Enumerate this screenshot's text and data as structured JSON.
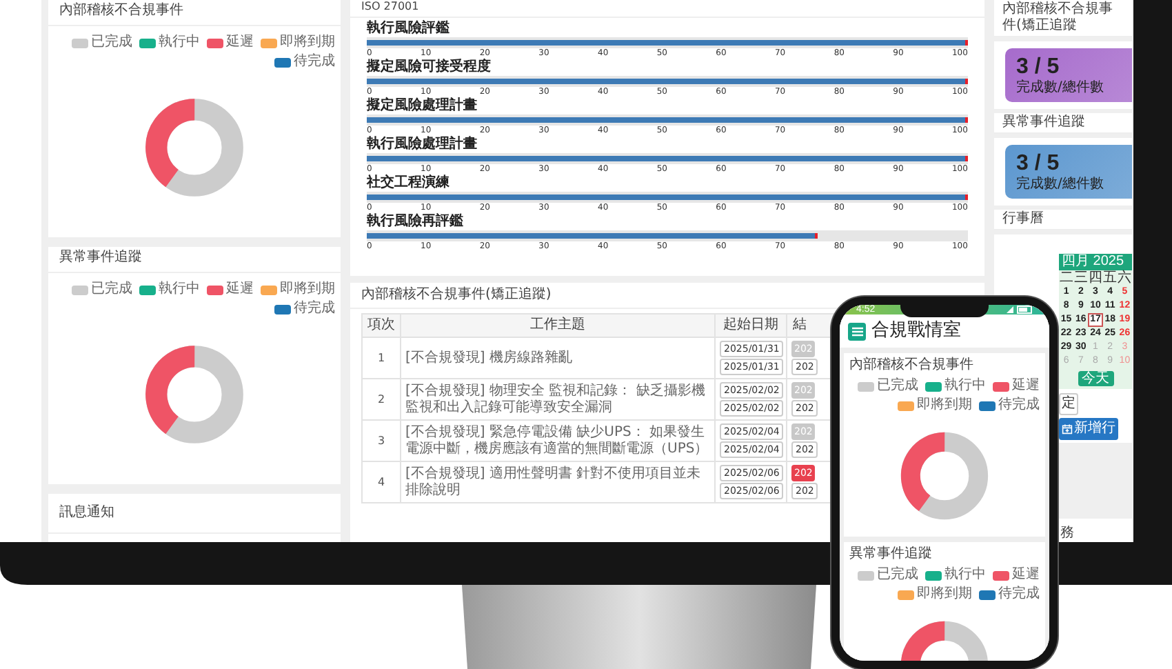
{
  "screen": {
    "left_column": [
      {
        "kind": "donut",
        "title": "內部稽核不合規事件",
        "legend": [
          {
            "label": "已完成",
            "color": "#cccccc"
          },
          {
            "label": "執行中",
            "color": "#17b08b"
          },
          {
            "label": "延遲",
            "color": "#ef5466"
          },
          {
            "label": "即將到期",
            "color": "#f9a851"
          },
          {
            "label": "待完成",
            "color": "#1f77b4"
          }
        ]
      },
      {
        "kind": "donut",
        "title": "異常事件追蹤",
        "legend": [
          {
            "label": "已完成",
            "color": "#cccccc"
          },
          {
            "label": "執行中",
            "color": "#17b08b"
          },
          {
            "label": "延遲",
            "color": "#ef5466"
          },
          {
            "label": "即將到期",
            "color": "#f9a851"
          },
          {
            "label": "待完成",
            "color": "#1f77b4"
          }
        ]
      },
      {
        "kind": "empty",
        "title": "訊息通知"
      }
    ],
    "iso_panel": {
      "title": "ISO 27001",
      "gauges": [
        {
          "label": "執行風險評鑑",
          "level": 1,
          "ticks": [
            "0",
            "10",
            "20",
            "30",
            "40",
            "50",
            "60",
            "70",
            "80",
            "90",
            "100"
          ]
        },
        {
          "label": "擬定風險可接受程度",
          "level": 1,
          "ticks": [
            "0",
            "10",
            "20",
            "30",
            "40",
            "50",
            "60",
            "70",
            "80",
            "90",
            "100"
          ]
        },
        {
          "label": "擬定風險處理計畫",
          "level": 1,
          "ticks": [
            "0",
            "10",
            "20",
            "30",
            "40",
            "50",
            "60",
            "70",
            "80",
            "90",
            "100"
          ]
        },
        {
          "label": "執行風險處理計畫",
          "level": 1,
          "ticks": [
            "0",
            "10",
            "20",
            "30",
            "40",
            "50",
            "60",
            "70",
            "80",
            "90",
            "100"
          ]
        },
        {
          "label": "社交工程演練",
          "level": 1,
          "ticks": [
            "0",
            "10",
            "20",
            "30",
            "40",
            "50",
            "60",
            "70",
            "80",
            "90",
            "100"
          ]
        },
        {
          "label": "執行風險再評鑑",
          "level": 0.75,
          "ticks": [
            "0",
            "10",
            "20",
            "30",
            "40",
            "50",
            "60",
            "70",
            "80",
            "90",
            "100"
          ]
        }
      ]
    },
    "table_panel": {
      "title": "內部稽核不合規事件(矯正追蹤)",
      "columns": [
        "項次",
        "工作主題",
        "起始日期",
        "結"
      ],
      "rows": [
        {
          "index": "1",
          "subject": "[不合規發現] 機房線路雜亂",
          "start_dates": [
            "2025/01/31",
            "2025/01/31"
          ],
          "end_status": {
            "text": "202",
            "color": "#c8c8c8"
          },
          "end_date": "202"
        },
        {
          "index": "2",
          "subject": "[不合規發現] 物理安全 監視和記錄： 缺乏攝影機監視和出入記錄可能導致安全漏洞",
          "start_dates": [
            "2025/02/02",
            "2025/02/02"
          ],
          "end_status": {
            "text": "202",
            "color": "#c8c8c8"
          },
          "end_date": "202"
        },
        {
          "index": "3",
          "subject": "[不合規發現] 緊急停電設備 缺少UPS： 如果發生電源中斷，機房應該有適當的無間斷電源（UPS）",
          "start_dates": [
            "2025/02/04",
            "2025/02/04"
          ],
          "end_status": {
            "text": "202",
            "color": "#c8c8c8"
          },
          "end_date": "202"
        },
        {
          "index": "4",
          "subject": "[不合規發現] 適用性聲明書 針對不使用項目並未排除說明",
          "start_dates": [
            "2025/02/06",
            "2025/02/06"
          ],
          "end_status": {
            "text": "202",
            "color": "#e8414f"
          },
          "end_date": "202"
        }
      ]
    },
    "right_column": {
      "cards": [
        {
          "title": "內部稽核不合規事件(矯正追蹤",
          "value": "3 / 5",
          "caption": "完成數/總件數",
          "color": "#a66bcc"
        },
        {
          "title": "異常事件追蹤",
          "value": "3 / 5",
          "caption": "完成數/總件數",
          "color": "#5c97cf"
        }
      ],
      "calendar": {
        "title": "行事曆",
        "month": "四月 2025",
        "weekdays": [
          "二",
          "三",
          "四",
          "五",
          "六"
        ],
        "weeks": [
          [
            {
              "day": "1",
              "kind": "day"
            },
            {
              "day": "2",
              "kind": "day"
            },
            {
              "day": "3",
              "kind": "day"
            },
            {
              "day": "4",
              "kind": "day"
            },
            {
              "day": "5",
              "kind": "weekend"
            }
          ],
          [
            {
              "day": "8",
              "kind": "day"
            },
            {
              "day": "9",
              "kind": "day"
            },
            {
              "day": "10",
              "kind": "day"
            },
            {
              "day": "11",
              "kind": "day"
            },
            {
              "day": "12",
              "kind": "weekend"
            }
          ],
          [
            {
              "day": "15",
              "kind": "day"
            },
            {
              "day": "16",
              "kind": "day"
            },
            {
              "day": "17",
              "kind": "today"
            },
            {
              "day": "18",
              "kind": "day"
            },
            {
              "day": "19",
              "kind": "weekend"
            }
          ],
          [
            {
              "day": "22",
              "kind": "day"
            },
            {
              "day": "23",
              "kind": "day"
            },
            {
              "day": "24",
              "kind": "day"
            },
            {
              "day": "25",
              "kind": "day"
            },
            {
              "day": "26",
              "kind": "weekend"
            }
          ],
          [
            {
              "day": "29",
              "kind": "day"
            },
            {
              "day": "30",
              "kind": "day"
            },
            {
              "day": "1",
              "kind": "other"
            },
            {
              "day": "2",
              "kind": "other"
            },
            {
              "day": "3",
              "kind": "other_weekend"
            }
          ],
          [
            {
              "day": "6",
              "kind": "other"
            },
            {
              "day": "7",
              "kind": "other"
            },
            {
              "day": "8",
              "kind": "other"
            },
            {
              "day": "9",
              "kind": "other"
            },
            {
              "day": "10",
              "kind": "other_weekend"
            }
          ]
        ],
        "today_button": "今天",
        "buttons": [
          {
            "label": "定",
            "kind": "plain"
          },
          {
            "label": "新增行",
            "kind": "primary"
          }
        ]
      },
      "footer_title": "務"
    }
  },
  "phone": {
    "time": "4:52",
    "app_title": "合規戰情室",
    "panels": [
      {
        "title": "內部稽核不合規事件",
        "legend": [
          {
            "label": "已完成",
            "color": "#cccccc"
          },
          {
            "label": "執行中",
            "color": "#17b08b"
          },
          {
            "label": "延遲",
            "color": "#ef5466"
          },
          {
            "label": "即將到期",
            "color": "#f9a851"
          },
          {
            "label": "待完成",
            "color": "#1f77b4"
          }
        ]
      },
      {
        "title": "異常事件追蹤",
        "legend": [
          {
            "label": "已完成",
            "color": "#cccccc"
          },
          {
            "label": "執行中",
            "color": "#17b08b"
          },
          {
            "label": "延遲",
            "color": "#ef5466"
          },
          {
            "label": "即將到期",
            "color": "#f9a851"
          },
          {
            "label": "待完成",
            "color": "#1f77b4"
          }
        ]
      }
    ]
  }
}
